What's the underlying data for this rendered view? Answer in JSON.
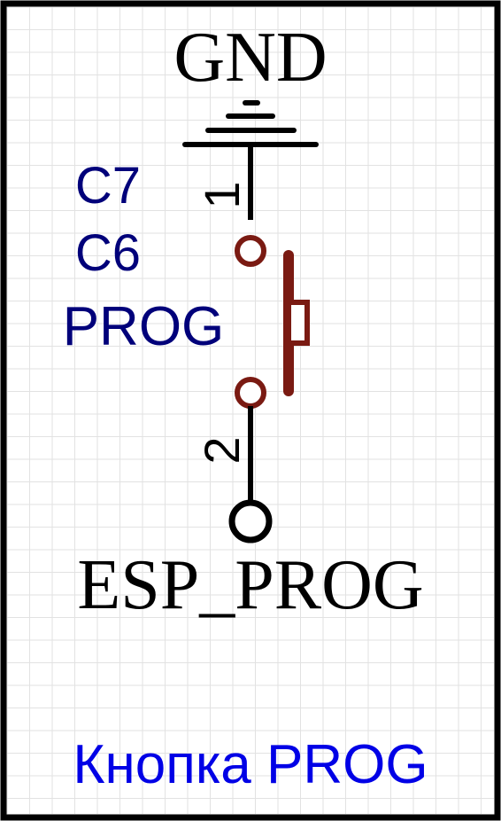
{
  "schematic": {
    "net_top": "GND",
    "net_bottom": "ESP_PROG",
    "designators": [
      "C7",
      "C6",
      "PROG"
    ],
    "pin_top": "1",
    "pin_bottom": "2",
    "caption": "Кнопка PROG"
  },
  "colors": {
    "background": "#ffffff",
    "grid": "#e2e2e2",
    "frame": "#000000",
    "wire": "#000000",
    "net_label": "#000000",
    "designator": "#00007a",
    "component": "#7a1a12",
    "caption": "#0000e6"
  },
  "icons": {
    "ground": "ground-symbol-icon",
    "net_port": "net-port-icon",
    "switch": "pushbutton-switch-icon"
  }
}
